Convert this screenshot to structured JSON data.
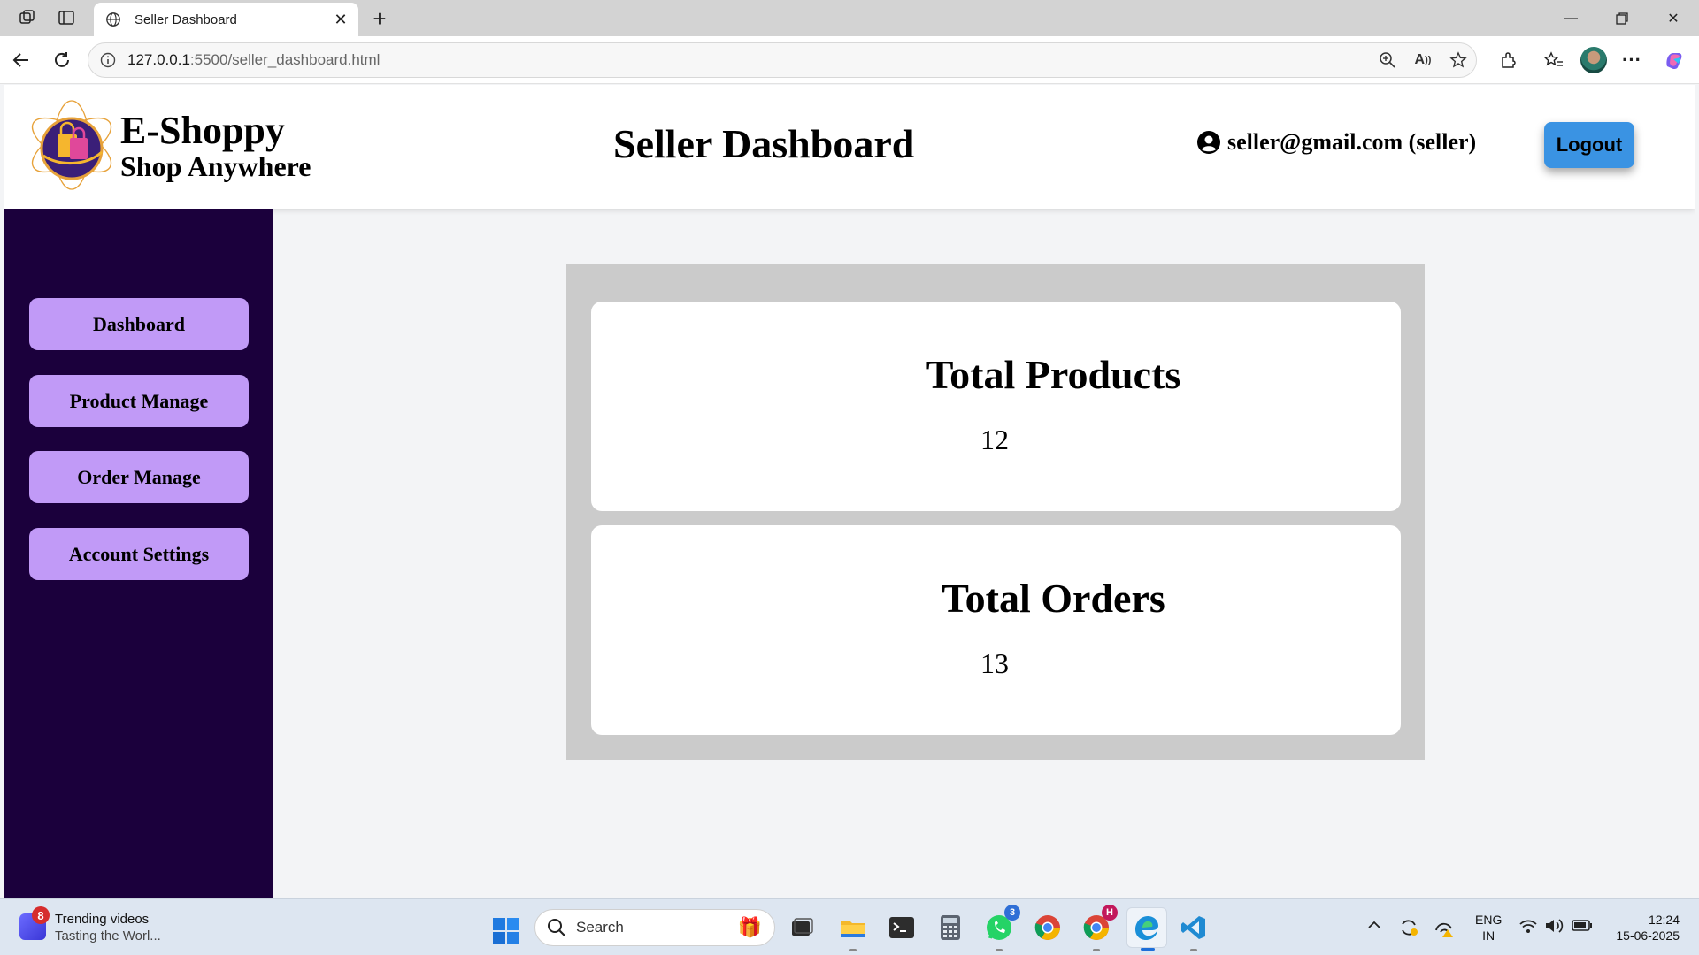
{
  "browser": {
    "tab_title": "Seller Dashboard",
    "url_host": "127.0.0.1",
    "url_rest": ":5500/seller_dashboard.html"
  },
  "header": {
    "brand_name": "E-Shoppy",
    "brand_tagline": "Shop Anywhere",
    "page_title": "Seller Dashboard",
    "user_label": "seller@gmail.com (seller)",
    "logout_label": "Logout"
  },
  "sidebar": {
    "items": [
      {
        "label": "Dashboard"
      },
      {
        "label": "Product Manage"
      },
      {
        "label": "Order Manage"
      },
      {
        "label": "Account Settings"
      }
    ]
  },
  "stats": [
    {
      "title": "Total Products",
      "value": "12"
    },
    {
      "title": "Total Orders",
      "value": "13"
    }
  ],
  "taskbar": {
    "widget_badge": "8",
    "widget_title": "Trending videos",
    "widget_subtitle": "Tasting the Worl...",
    "search_placeholder": "Search",
    "whatsapp_badge": "3",
    "chrome_profile_badge": "H",
    "lang_line1": "ENG",
    "lang_line2": "IN",
    "time": "12:24",
    "date": "15-06-2025"
  },
  "colors": {
    "sidebar_bg": "#1b003c",
    "sidebar_button": "#c19af7",
    "logout_button": "#3a93e3",
    "stats_panel": "#cbcbcb"
  }
}
